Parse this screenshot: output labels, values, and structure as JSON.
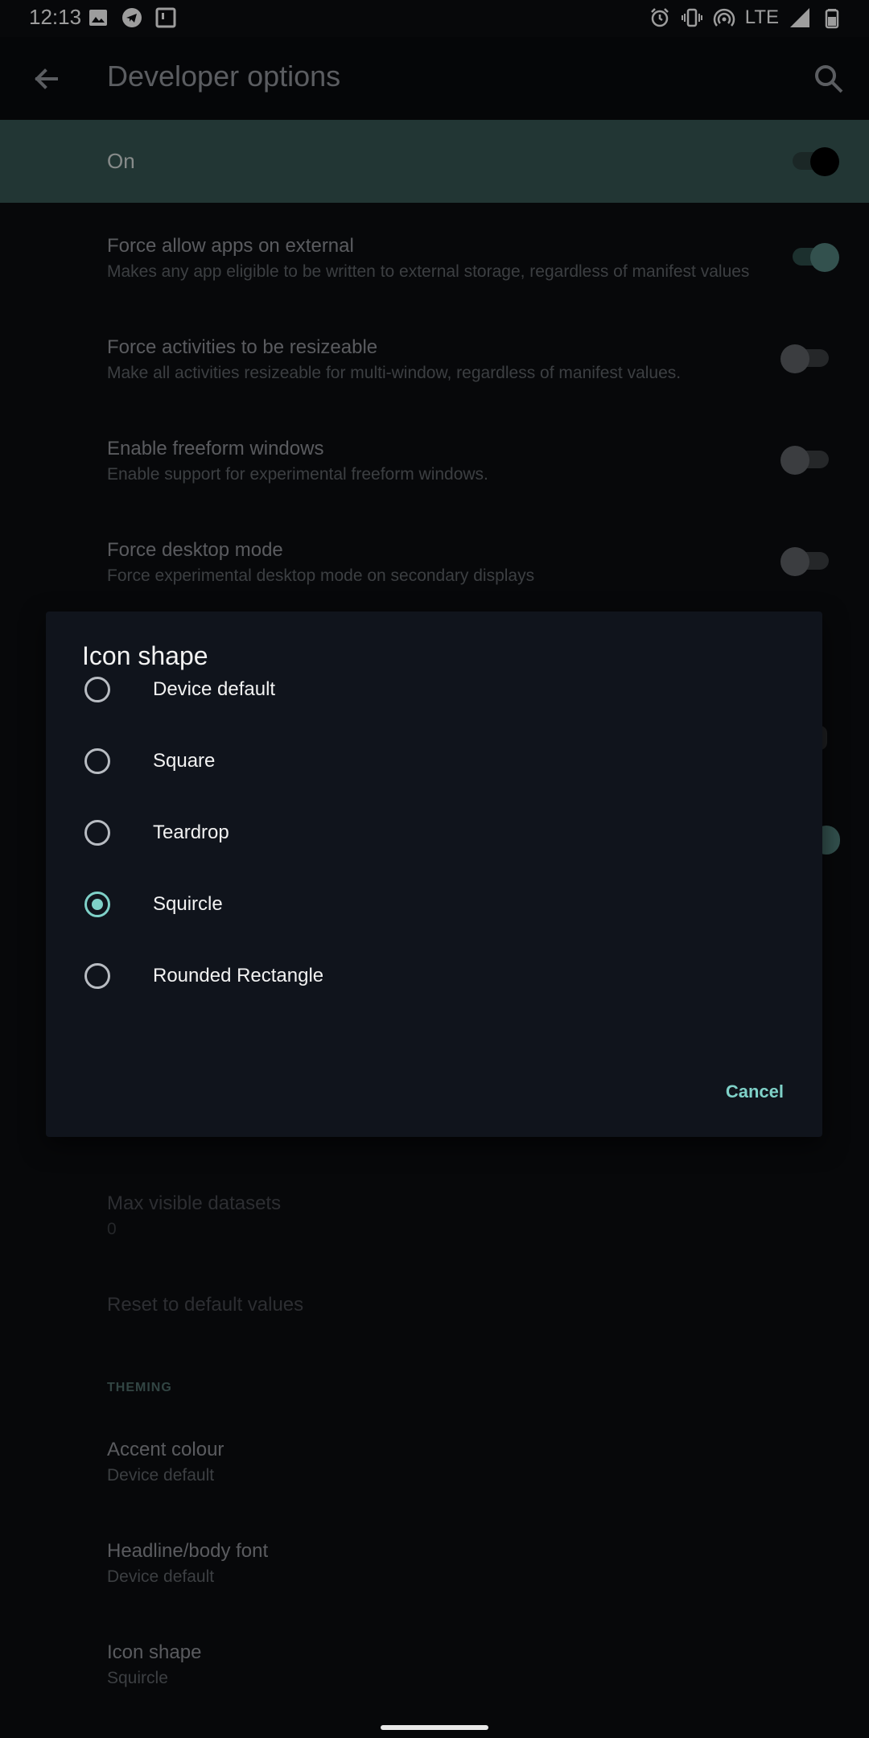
{
  "status_bar": {
    "time": "12:13",
    "network": "LTE",
    "icons": [
      "gallery-icon",
      "telegram-icon",
      "notification-icon",
      "alarm-icon",
      "vibrate-icon",
      "hotspot-icon",
      "signal-icon",
      "battery-icon"
    ]
  },
  "toolbar": {
    "title": "Developer options",
    "back_icon": "back-arrow-icon",
    "search_icon": "search-icon"
  },
  "master_switch": {
    "label": "On",
    "checked": true
  },
  "settings": [
    {
      "title": "Force allow apps on external",
      "subtitle": "Makes any app eligible to be written to external storage, regardless of manifest values",
      "toggle": true
    },
    {
      "title": "Force activities to be resizeable",
      "subtitle": "Make all activities resizeable for multi-window, regardless of manifest values.",
      "toggle": false
    },
    {
      "title": "Enable freeform windows",
      "subtitle": "Enable support for experimental freeform windows.",
      "toggle": false
    },
    {
      "title": "Force desktop mode",
      "subtitle": "Force experimental desktop mode on secondary displays",
      "toggle": false
    }
  ],
  "lower_settings": {
    "max_visible_datasets": {
      "title": "Max visible datasets",
      "value": "0"
    },
    "reset": {
      "title": "Reset to default values"
    },
    "theming_header": "THEMING",
    "accent": {
      "title": "Accent colour",
      "value": "Device default"
    },
    "font": {
      "title": "Headline/body font",
      "value": "Device default"
    },
    "icon_shape": {
      "title": "Icon shape",
      "value": "Squircle"
    }
  },
  "dialog": {
    "title": "Icon shape",
    "options": [
      {
        "label": "Device default",
        "selected": false
      },
      {
        "label": "Square",
        "selected": false
      },
      {
        "label": "Teardrop",
        "selected": false
      },
      {
        "label": "Squircle",
        "selected": true
      },
      {
        "label": "Rounded Rectangle",
        "selected": false
      }
    ],
    "cancel_label": "Cancel"
  },
  "colors": {
    "accent": "#7fd1c8",
    "master_bar": "#355451",
    "background": "#0b0d10",
    "dialog": "#10141c"
  }
}
